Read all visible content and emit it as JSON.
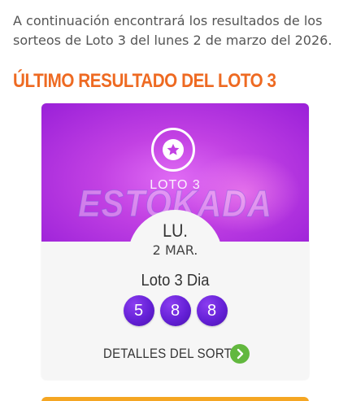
{
  "intro": {
    "text": "A continuación encontrará los resultados de los sorteos de Loto 3 del lunes 2 de marzo del 2026."
  },
  "section": {
    "title": "ÚLTIMO RESULTADO DEL LOTO 3"
  },
  "result_card": {
    "game_name": "LOTO 3",
    "watermark": "ESTOKADA",
    "weekday": "LU.",
    "date": "2 MAR.",
    "draw_name": "Loto 3 Dia",
    "numbers": [
      "5",
      "8",
      "8"
    ],
    "details_label": "DETALLES DEL SORTEO",
    "icon": "star-icon",
    "details_icon": "chevron-right-icon"
  },
  "colors": {
    "section_title": "#ee6a22",
    "hero_purple": "#c241e3",
    "ball": "#6420d6",
    "details_button": "#62b83e",
    "next_card": "#f5a623"
  }
}
